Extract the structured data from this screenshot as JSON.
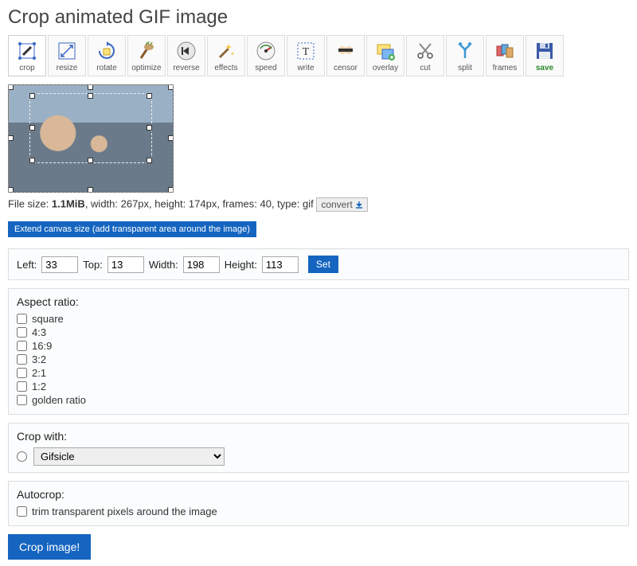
{
  "title": "Crop animated GIF image",
  "toolbar": [
    {
      "key": "crop",
      "label": "crop",
      "active": true
    },
    {
      "key": "resize",
      "label": "resize"
    },
    {
      "key": "rotate",
      "label": "rotate"
    },
    {
      "key": "optimize",
      "label": "optimize"
    },
    {
      "key": "reverse",
      "label": "reverse"
    },
    {
      "key": "effects",
      "label": "effects"
    },
    {
      "key": "speed",
      "label": "speed"
    },
    {
      "key": "write",
      "label": "write"
    },
    {
      "key": "censor",
      "label": "censor"
    },
    {
      "key": "overlay",
      "label": "overlay"
    },
    {
      "key": "cut",
      "label": "cut"
    },
    {
      "key": "split",
      "label": "split"
    },
    {
      "key": "frames",
      "label": "frames"
    },
    {
      "key": "save",
      "label": "save"
    }
  ],
  "fileinfo": {
    "prefix": "File size: ",
    "size": "1.1MiB",
    "rest": ", width: 267px, height: 174px, frames: 40, type: gif",
    "convert_label": "convert"
  },
  "extend_label": "Extend canvas size (add transparent area around the image)",
  "dims": {
    "left_label": "Left:",
    "left_value": "33",
    "top_label": "Top:",
    "top_value": "13",
    "width_label": "Width:",
    "width_value": "198",
    "height_label": "Height:",
    "height_value": "113",
    "set_label": "Set"
  },
  "aspect": {
    "label": "Aspect ratio:",
    "options": [
      "square",
      "4:3",
      "16:9",
      "3:2",
      "2:1",
      "1:2",
      "golden ratio"
    ]
  },
  "cropwith": {
    "label": "Crop with:",
    "selected": "Gifsicle"
  },
  "autocrop": {
    "label": "Autocrop:",
    "option": "trim transparent pixels around the image"
  },
  "crop_button": "Crop image!"
}
